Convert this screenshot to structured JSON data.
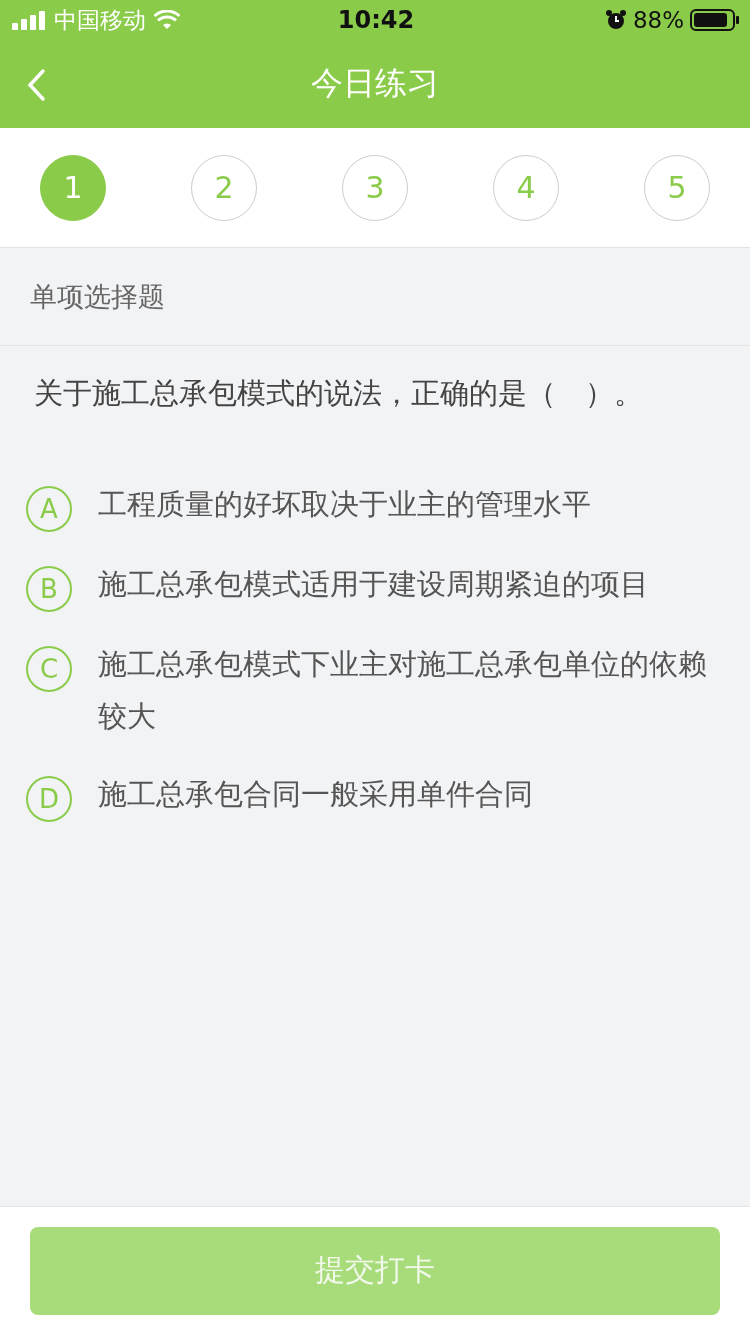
{
  "status_bar": {
    "carrier": "中国移动",
    "time": "10:42",
    "battery": "88%"
  },
  "nav": {
    "title": "今日练习"
  },
  "steps": [
    {
      "label": "1",
      "selected": true
    },
    {
      "label": "2",
      "selected": false
    },
    {
      "label": "3",
      "selected": false
    },
    {
      "label": "4",
      "selected": false
    },
    {
      "label": "5",
      "selected": false
    }
  ],
  "section_title": "单项选择题",
  "question": "关于施工总承包模式的说法，正确的是（　）。",
  "options": [
    {
      "letter": "A",
      "text": "工程质量的好坏取决于业主的管理水平",
      "selected": false
    },
    {
      "letter": "B",
      "text": "施工总承包模式适用于建设周期紧迫的项目",
      "selected": false
    },
    {
      "letter": "C",
      "text": "施工总承包模式下业主对施工总承包单位的依赖较大",
      "selected": false
    },
    {
      "letter": "D",
      "text": "施工总承包合同一般采用单件合同",
      "selected": false
    }
  ],
  "submit": {
    "label": "提交打卡",
    "disabled": true
  }
}
